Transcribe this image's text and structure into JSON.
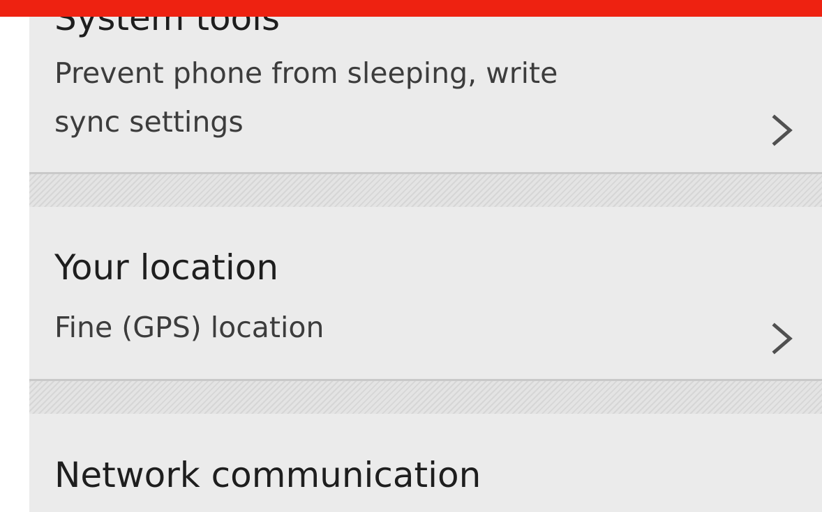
{
  "permissions": {
    "items": [
      {
        "title": "System tools",
        "description_line1": "Prevent phone from sleeping, write",
        "description_line2": "sync settings",
        "chevron_icon": "chevron-right-icon"
      },
      {
        "title": "Your location",
        "description_line1": "Fine (GPS) location",
        "chevron_icon": "chevron-right-icon"
      },
      {
        "title": "Network communication"
      }
    ]
  },
  "colors": {
    "top_bar": "#ee2211",
    "panel_background": "#ebebeb",
    "separator": "#c9c9c9",
    "title_text": "#1e1e1e",
    "description_text": "#3c3c3c"
  }
}
